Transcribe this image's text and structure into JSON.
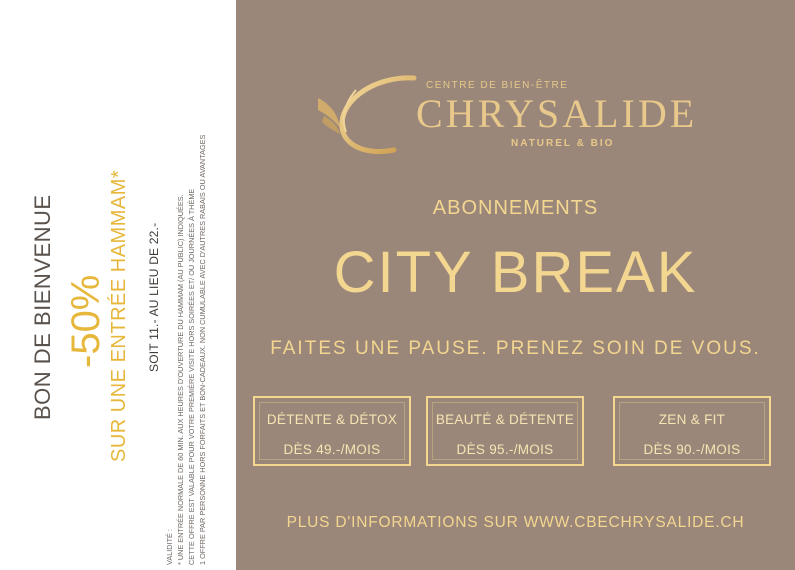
{
  "coupon": {
    "welcome": "BON DE BIENVENUE",
    "discount": "-50%",
    "offer": "SUR UNE ENTRÉE HAMMAM*",
    "price_note": "SOIT 11.- AU LIEU DE 22.-",
    "fine_print": [
      "VALIDITÉ :",
      "* UNE ENTRÉE NORMALE DE 60 MIN. AUX HEURES D'OUVERTURE DU HAMMAM (AU PUBLIC) INDIQUÉES.",
      "CETTE OFFRE EST VALABLE POUR VOTRE PREMIÈRE VISITE  HORS SOIRÉES ET/ OU  JOURNÉES À THÈME",
      "1 OFFRE PAR PERSONNE  HORS FORFAITS ET BON-CADEAUX. NON CUMULABLE AVEC D'AUTRES RABAIS OU AVANTAGES"
    ]
  },
  "logo": {
    "tagline_top": "CENTRE DE BIEN-ÊTRE",
    "brand": "CHRYSALIDE",
    "tagline_bottom": "NATUREL & BIO"
  },
  "main": {
    "subtitle": "ABONNEMENTS",
    "headline": "CITY BREAK",
    "slogan": "FAITES UNE PAUSE. PRENEZ SOIN DE VOUS.",
    "plans": [
      {
        "name": "DÉTENTE & DÉTOX",
        "price": "DÈS 49.-/MOIS"
      },
      {
        "name": "BEAUTÉ & DÉTENTE",
        "price": "DÈS 95.-/MOIS"
      },
      {
        "name": "ZEN & FIT",
        "price": "DÈS 90.-/MOIS"
      }
    ],
    "info": "PLUS D'INFORMATIONS SUR WWW.CBECHRYSALIDE.CH"
  },
  "colors": {
    "panel_bg": "#9b877a",
    "gold": "#f3d690",
    "coupon_accent": "#e6b73a"
  }
}
